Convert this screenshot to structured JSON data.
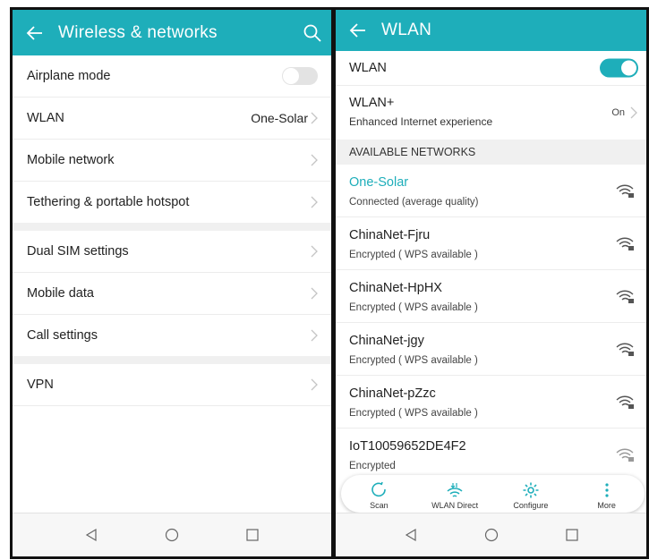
{
  "left": {
    "title": "Wireless & networks",
    "items": [
      {
        "label": "Airplane mode"
      },
      {
        "label": "WLAN",
        "value": "One-Solar"
      },
      {
        "label": "Mobile network"
      },
      {
        "label": "Tethering & portable hotspot"
      },
      {
        "label": "Dual SIM settings"
      },
      {
        "label": "Mobile data"
      },
      {
        "label": "Call settings"
      },
      {
        "label": "VPN"
      }
    ]
  },
  "right": {
    "title": "WLAN",
    "wlan_label": "WLAN",
    "wlan_plus": {
      "label": "WLAN+",
      "subtitle": "Enhanced Internet experience",
      "value": "On"
    },
    "section_header": "AVAILABLE NETWORKS",
    "networks": [
      {
        "name": "One-Solar",
        "status": "Connected (average quality)"
      },
      {
        "name": "ChinaNet-Fjru",
        "status": "Encrypted ( WPS available )"
      },
      {
        "name": "ChinaNet-HpHX",
        "status": "Encrypted ( WPS available )"
      },
      {
        "name": "ChinaNet-jgy",
        "status": "Encrypted ( WPS available )"
      },
      {
        "name": "ChinaNet-pZzc",
        "status": "Encrypted ( WPS available )"
      },
      {
        "name": "IoT10059652DE4F2",
        "status": "Encrypted"
      }
    ],
    "actions": {
      "scan": "Scan",
      "wlan_direct": "WLAN Direct",
      "configure": "Configure",
      "more": "More"
    }
  },
  "colors": {
    "accent": "#1eaeba"
  },
  "icons": [
    "back-arrow-icon",
    "search-icon",
    "chevron-right-icon",
    "wifi-lock-icon",
    "scan-icon",
    "wlan-direct-icon",
    "gear-icon",
    "more-vertical-icon",
    "nav-back-icon",
    "nav-home-icon",
    "nav-recents-icon"
  ]
}
